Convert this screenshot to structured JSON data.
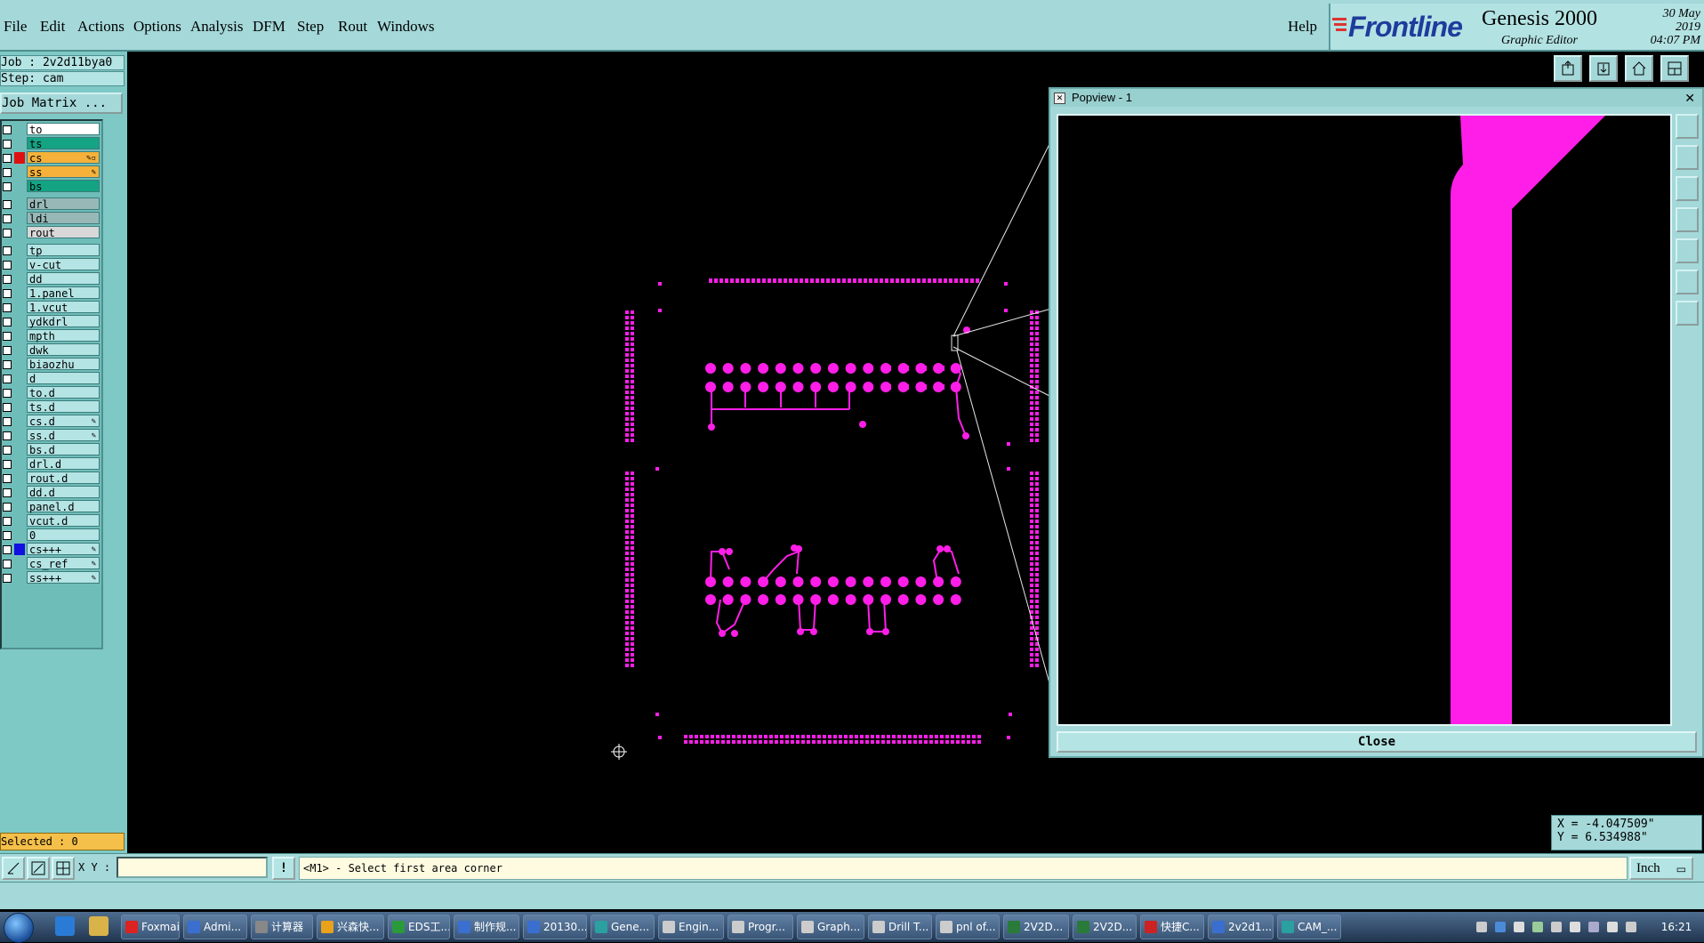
{
  "menubar": {
    "items": [
      "File",
      "Edit",
      "Actions",
      "Options",
      "Analysis",
      "DFM",
      "Step",
      "Rout",
      "Windows"
    ],
    "help": "Help"
  },
  "brand": {
    "logo": "Frontline",
    "product": "Genesis 2000",
    "subtitle": "Graphic Editor",
    "date": "30 May 2019",
    "time": "04:07 PM"
  },
  "left_panel": {
    "job": "Job : 2v2d11bya0",
    "step": "Step: cam",
    "job_matrix": "Job Matrix ...",
    "layers": [
      {
        "name": "to",
        "color": "#ffffff",
        "mark": ""
      },
      {
        "name": "ts",
        "color": "#14a383",
        "mark": ""
      },
      {
        "name": "cs",
        "color": "#f5b13a",
        "mark": "#e01010",
        "icons": "✎▫"
      },
      {
        "name": "ss",
        "color": "#f5b13a",
        "mark": "",
        "icons": "✎"
      },
      {
        "name": "bs",
        "color": "#14a383",
        "mark": ""
      },
      {
        "name": "drl",
        "color": "#98b8b8",
        "mark": ""
      },
      {
        "name": "ldi",
        "color": "#98b8b8",
        "mark": ""
      },
      {
        "name": "rout",
        "color": "#d8d8d8",
        "mark": ""
      },
      {
        "name": "tp",
        "color": "#b4e4e4",
        "mark": ""
      },
      {
        "name": "v-cut",
        "color": "#b4e4e4",
        "mark": ""
      },
      {
        "name": "dd",
        "color": "#b4e4e4",
        "mark": ""
      },
      {
        "name": "1.panel",
        "color": "#b4e4e4",
        "mark": ""
      },
      {
        "name": "1.vcut",
        "color": "#b4e4e4",
        "mark": ""
      },
      {
        "name": "ydkdrl",
        "color": "#b4e4e4",
        "mark": ""
      },
      {
        "name": "mpth",
        "color": "#b4e4e4",
        "mark": ""
      },
      {
        "name": "dwk",
        "color": "#b4e4e4",
        "mark": ""
      },
      {
        "name": "biaozhu",
        "color": "#b4e4e4",
        "mark": ""
      },
      {
        "name": "d",
        "color": "#b4e4e4",
        "mark": ""
      },
      {
        "name": "to.d",
        "color": "#b4e4e4",
        "mark": ""
      },
      {
        "name": "ts.d",
        "color": "#b4e4e4",
        "mark": ""
      },
      {
        "name": "cs.d",
        "color": "#b4e4e4",
        "mark": "",
        "icons": "✎"
      },
      {
        "name": "ss.d",
        "color": "#b4e4e4",
        "mark": "",
        "icons": "✎"
      },
      {
        "name": "bs.d",
        "color": "#b4e4e4",
        "mark": ""
      },
      {
        "name": "drl.d",
        "color": "#b4e4e4",
        "mark": ""
      },
      {
        "name": "rout.d",
        "color": "#b4e4e4",
        "mark": ""
      },
      {
        "name": "dd.d",
        "color": "#b4e4e4",
        "mark": ""
      },
      {
        "name": "panel.d",
        "color": "#b4e4e4",
        "mark": ""
      },
      {
        "name": "vcut.d",
        "color": "#b4e4e4",
        "mark": ""
      },
      {
        "name": "0",
        "color": "#b4e4e4",
        "mark": ""
      },
      {
        "name": "cs+++",
        "color": "#b4e4e4",
        "mark": "#1010e0",
        "icons": "✎"
      },
      {
        "name": "cs_ref",
        "color": "#b4e4e4",
        "mark": "",
        "icons": "✎"
      },
      {
        "name": "ss+++",
        "color": "#b4e4e4",
        "mark": "",
        "icons": "✎"
      }
    ],
    "selected": "Selected : 0"
  },
  "popview": {
    "title": "Popview - 1",
    "close_label": "Close"
  },
  "coords": {
    "x": "X = -4.047509\"",
    "y": "Y = 6.534988\""
  },
  "cmdbar": {
    "xy_label": "X Y :",
    "xy_value": "",
    "prompt": "<M1> - Select first area corner",
    "unit": "Inch"
  },
  "taskbar": {
    "items": [
      {
        "label": "Foxmail",
        "color": "#d22"
      },
      {
        "label": "Admi...",
        "color": "#3a6fd0"
      },
      {
        "label": "计算器",
        "color": "#888"
      },
      {
        "label": "兴森快...",
        "color": "#e9a21a"
      },
      {
        "label": "EDS工...",
        "color": "#2a9a3a"
      },
      {
        "label": "制作规...",
        "color": "#3a6fd0"
      },
      {
        "label": "20130...",
        "color": "#3a6fd0"
      },
      {
        "label": "Gene...",
        "color": "#2aa0a0"
      },
      {
        "label": "Engin...",
        "color": "#ccc"
      },
      {
        "label": "Progr...",
        "color": "#ccc"
      },
      {
        "label": "Graph...",
        "color": "#ccc"
      },
      {
        "label": "Drill T...",
        "color": "#ccc"
      },
      {
        "label": "pnl of...",
        "color": "#ccc"
      },
      {
        "label": "2V2D...",
        "color": "#2a7a3a"
      },
      {
        "label": "2V2D...",
        "color": "#2a7a3a"
      },
      {
        "label": "快捷C...",
        "color": "#c22"
      },
      {
        "label": "2v2d1...",
        "color": "#3a6fd0"
      },
      {
        "label": "CAM_...",
        "color": "#2aa0a0"
      }
    ],
    "clock": "16:21"
  },
  "colors": {
    "accent": "#a5d8d9",
    "trace": "#ff1ee8",
    "canvas": "#000000"
  }
}
